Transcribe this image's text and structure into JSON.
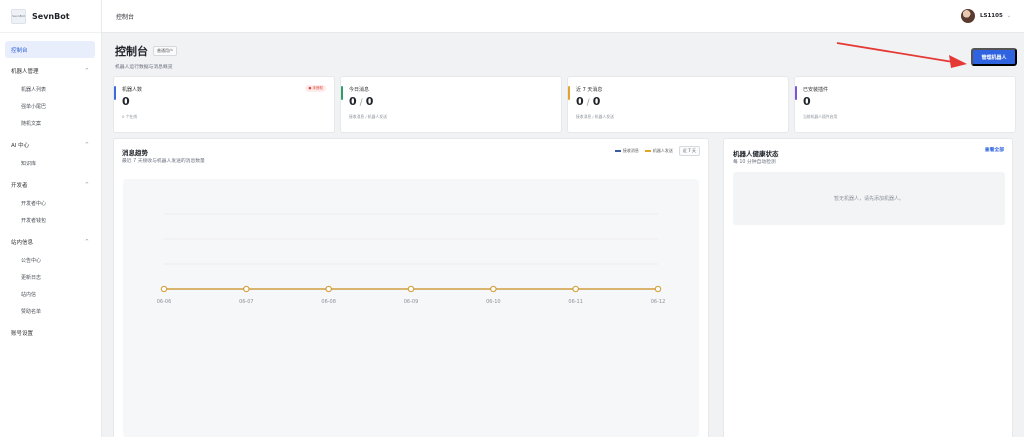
{
  "brand": {
    "logo_text": "SevnBot",
    "name": "SevnBot"
  },
  "topbar": {
    "title": "控制台",
    "username": "LS1105"
  },
  "sidebar": {
    "items": [
      {
        "label": "控制台",
        "active": true
      },
      {
        "label": "机器人管理",
        "children": [
          "机器人列表",
          "强单小尾巴",
          "随机文案"
        ]
      },
      {
        "label": "AI 中心",
        "children": [
          "知识库"
        ]
      },
      {
        "label": "开发者",
        "children": [
          "开发者中心",
          "开发者钱包"
        ]
      },
      {
        "label": "站内信息",
        "children": [
          "公告中心",
          "更新日志",
          "站内信",
          "赞助名单"
        ]
      },
      {
        "label": "账号设置"
      }
    ]
  },
  "page": {
    "title": "控制台",
    "role_badge": "普通用户",
    "subtitle": "机器人运行数据与消息概览",
    "manage_button": "管理机器人"
  },
  "stats": [
    {
      "label": "机器人数",
      "value": "0",
      "desc": "0 个在线",
      "tag": "● 未授权",
      "color": "#3d6bdf"
    },
    {
      "label": "今日消息",
      "value_a": "0",
      "value_b": "0",
      "desc": "接收消息 / 机器人发送",
      "color": "#2f9e6b"
    },
    {
      "label": "近 7 天消息",
      "value_a": "0",
      "value_b": "0",
      "desc": "接收消息 / 机器人发送",
      "color": "#e3a32b"
    },
    {
      "label": "已安装插件",
      "value": "0",
      "desc": "当前机器人插件启用",
      "color": "#7b56d8"
    }
  ],
  "trend": {
    "title": "消息趋势",
    "subtitle": "最近 7 天接收与机器人发送的消息数量",
    "range_button": "近 7 天"
  },
  "health": {
    "title": "机器人健康状态",
    "subtitle": "每 10 分钟自动检测",
    "view_all": "查看全部",
    "empty_text": "暂无机器人，请先添加机器人。"
  },
  "colors": {
    "accent": "#2f63e0",
    "received": "#3d5a9e",
    "sent": "#e3a32b"
  },
  "chart_data": {
    "type": "line",
    "x": [
      "06-06",
      "06-07",
      "06-08",
      "06-09",
      "06-10",
      "06-11",
      "06-12"
    ],
    "series": [
      {
        "name": "接收消息",
        "values": [
          0,
          0,
          0,
          0,
          0,
          0,
          0
        ]
      },
      {
        "name": "机器人发送",
        "values": [
          0,
          0,
          0,
          0,
          0,
          0,
          0
        ]
      }
    ],
    "grid": true
  }
}
